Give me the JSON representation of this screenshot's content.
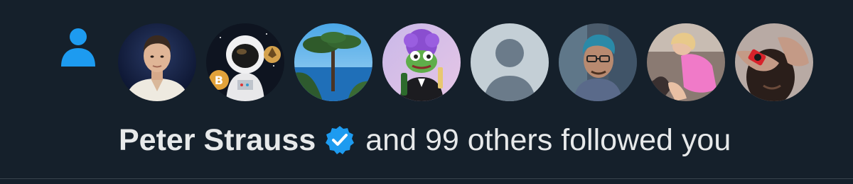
{
  "notification": {
    "type_icon": "person-icon",
    "actor_name": "Peter Strauss",
    "verified_badge": "verified-badge-icon",
    "rest_text": "and 99 others followed you",
    "avatars": [
      {
        "name": "avatar-man-portrait",
        "alt": "man-portrait"
      },
      {
        "name": "avatar-astronaut-crypto",
        "alt": "astronaut-with-crypto-coins"
      },
      {
        "name": "avatar-coastal-tree",
        "alt": "coastal-tree-landscape"
      },
      {
        "name": "avatar-pepe-frog",
        "alt": "frog-cartoon-with-bottles"
      },
      {
        "name": "avatar-default",
        "alt": "default-avatar"
      },
      {
        "name": "avatar-man-glasses",
        "alt": "man-with-glasses-art"
      },
      {
        "name": "avatar-pink-dress",
        "alt": "person-in-pink"
      },
      {
        "name": "avatar-red-watch",
        "alt": "person-with-red-watch"
      }
    ]
  },
  "colors": {
    "background": "#15202b",
    "text": "#e7e9ea",
    "accent": "#1d9bf0",
    "divider": "#38444d"
  }
}
